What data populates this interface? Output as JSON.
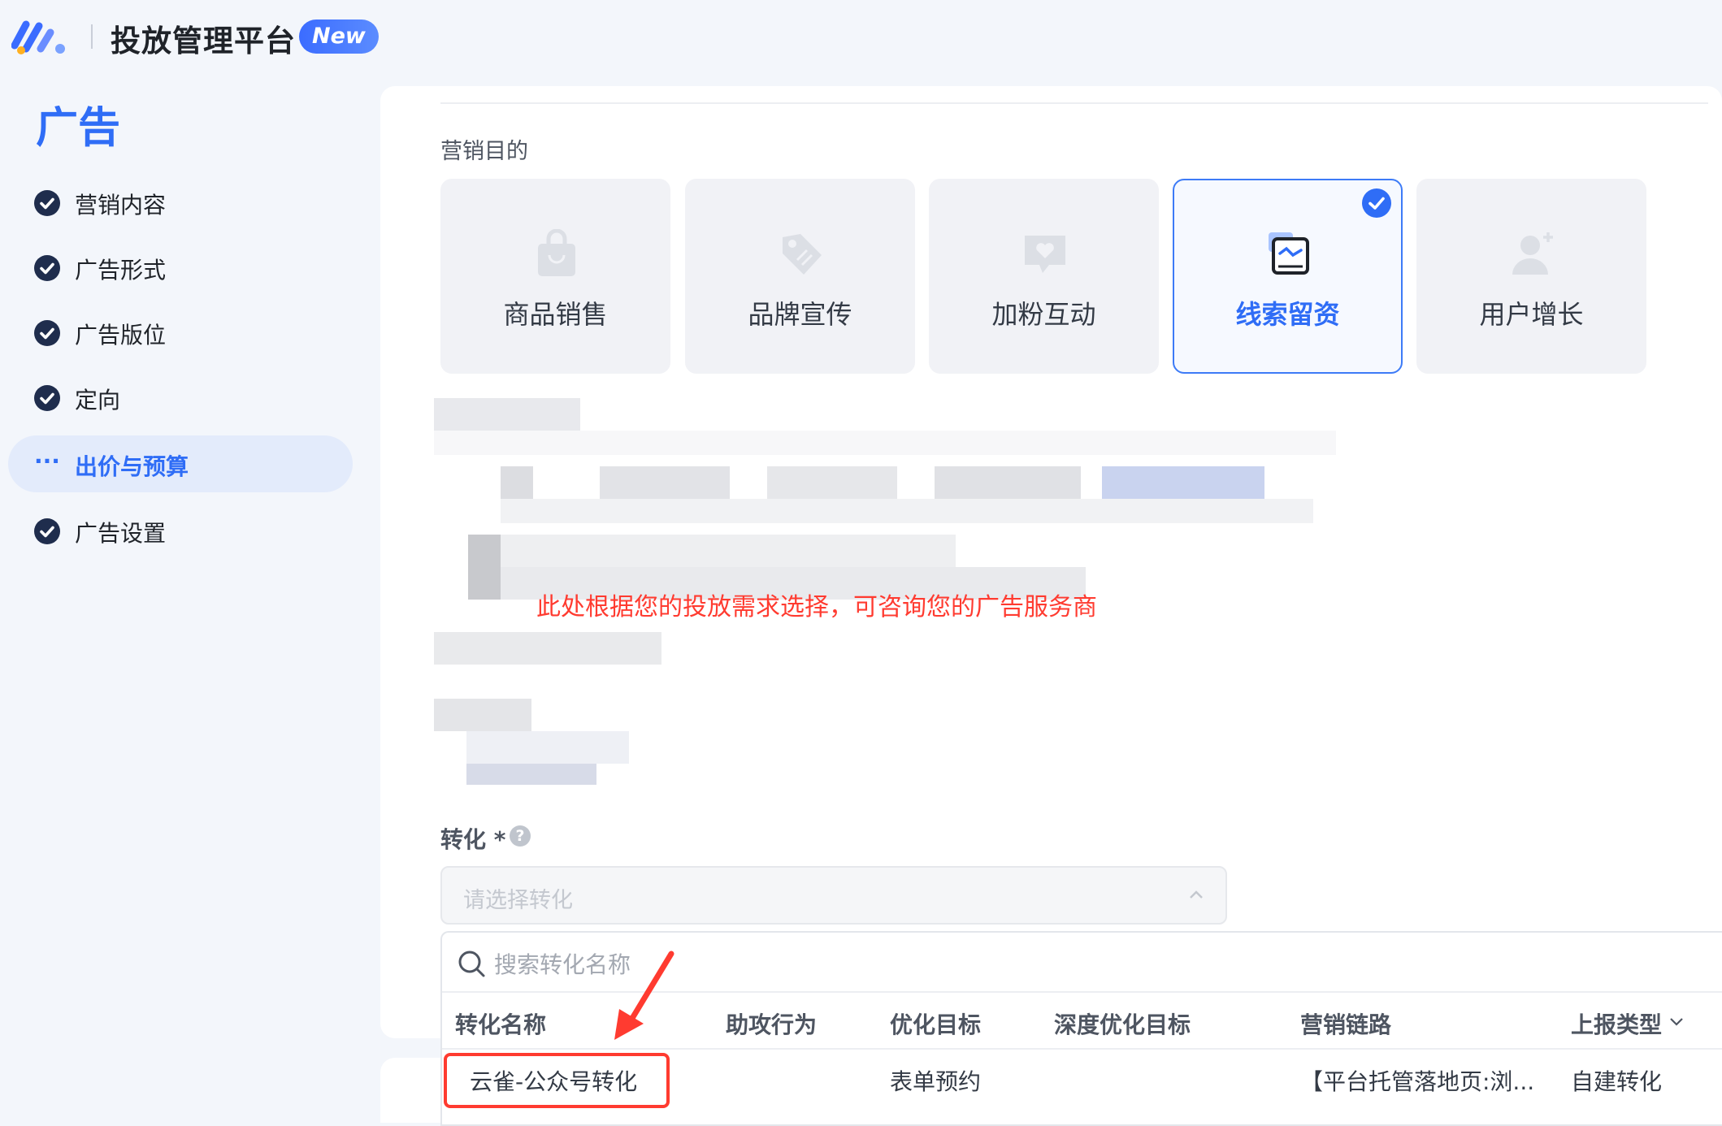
{
  "header": {
    "title": "投放管理平台",
    "badge": "New"
  },
  "sidebar": {
    "title": "广告",
    "items": [
      {
        "label": "营销内容",
        "state": "done"
      },
      {
        "label": "广告形式",
        "state": "done"
      },
      {
        "label": "广告版位",
        "state": "done"
      },
      {
        "label": "定向",
        "state": "done"
      },
      {
        "label": "出价与预算",
        "state": "active"
      },
      {
        "label": "广告设置",
        "state": "done"
      }
    ]
  },
  "main": {
    "section_label": "营销目的",
    "purposes": [
      {
        "label": "商品销售",
        "icon": "shopping-bag-icon",
        "selected": false
      },
      {
        "label": "品牌宣传",
        "icon": "tag-icon",
        "selected": false
      },
      {
        "label": "加粉互动",
        "icon": "heart-chat-icon",
        "selected": false
      },
      {
        "label": "线索留资",
        "icon": "lead-form-icon",
        "selected": true
      },
      {
        "label": "用户增长",
        "icon": "user-add-icon",
        "selected": false
      }
    ],
    "tip": "此处根据您的投放需求选择，可咨询您的广告服务商",
    "conversion": {
      "label": "转化",
      "required_mark": "*",
      "help": "?",
      "placeholder": "请选择转化",
      "search_placeholder": "搜索转化名称",
      "columns": [
        "转化名称",
        "助攻行为",
        "优化目标",
        "深度优化目标",
        "营销链路",
        "上报类型"
      ],
      "rows": [
        {
          "name": "云雀-公众号转化",
          "assist": "",
          "goal": "表单预约",
          "deep_goal": "",
          "chain": "【平台托管落地页:浏...",
          "report_type": "自建转化"
        }
      ]
    }
  },
  "colors": {
    "accent": "#2f6df6",
    "sidebar_active_bg": "#e3ebfb",
    "annotation_red": "#ff3b30",
    "page_bg": "#f3f6fb"
  }
}
